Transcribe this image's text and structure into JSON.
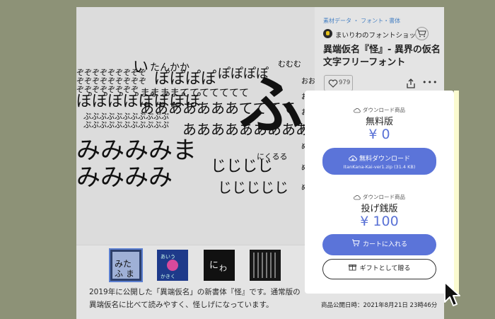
{
  "breadcrumb": "素材データ ・ フォント・書体",
  "shop": {
    "name": "まいりわのフォントショップ"
  },
  "product": {
    "title": "異端仮名『怪』- 異界の仮名文字フリーフォント",
    "likes": "979"
  },
  "plans": [
    {
      "label": "ダウンロード商品",
      "name": "無料版",
      "price": "¥ 0",
      "button": "無料ダウンロード",
      "file": "ItanKana-Kai-ver1.zip (31.4 KB)"
    },
    {
      "label": "ダウンロード商品",
      "name": "投げ銭版",
      "price": "¥ 100",
      "button": "カートに入れる",
      "gift_button": "ギフトとして贈る"
    }
  ],
  "description": "2019年に公開した「異端仮名」の新書体『怪』です。通常版の異端仮名に比べて読みやすく、怪しげになっています。",
  "published": "商品公開日時：2021年8月21日 23時46分",
  "colors": {
    "accent": "#5b74d9",
    "link": "#4a83c4",
    "price": "#5a72d6"
  },
  "icons": [
    "heart-icon",
    "share-icon",
    "more-icon",
    "cloud-download-icon",
    "cart-icon",
    "gift-icon",
    "mouse-cursor-icon"
  ]
}
